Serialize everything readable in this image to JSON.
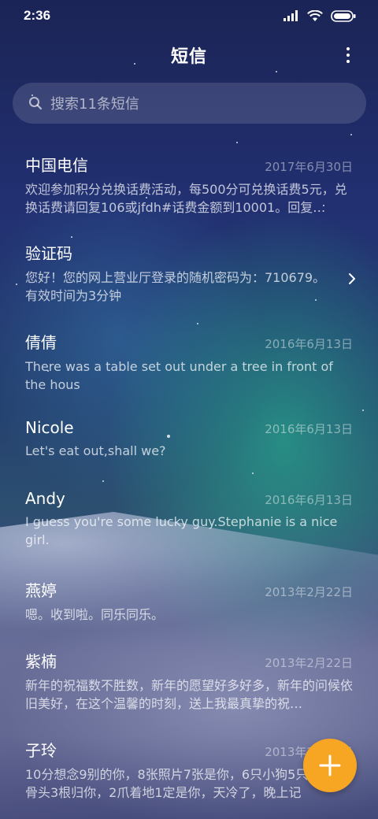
{
  "status_bar": {
    "time": "2:36",
    "icons": [
      "signal-icon",
      "wifi-icon",
      "battery-icon"
    ]
  },
  "header": {
    "title": "短信",
    "more_icon": "more-vertical-icon"
  },
  "search": {
    "icon": "search-icon",
    "placeholder": "搜索11条短信"
  },
  "conversations": [
    {
      "name": "中国电信",
      "date": "2017年6月30日",
      "preview": "欢迎参加积分兑换话费活动，每500分可兑换话费5元，兑换话费请回复106或jfdh#话费金额到10001。回复…"
    },
    {
      "name": "验证码",
      "date": "",
      "preview": "您好！您的网上营业厅登录的随机密码为：710679。有效时间为3分钟",
      "chevron": true
    },
    {
      "name": "倩倩",
      "date": "2016年6月13日",
      "preview": "There was a table set out under a tree in front of the hous"
    },
    {
      "name": "Nicole",
      "date": "2016年6月13日",
      "preview": "Let's eat out,shall we?"
    },
    {
      "name": "Andy",
      "date": "2016年6月13日",
      "preview": "I guess you're some lucky guy.Stephanie is a nice girl."
    },
    {
      "name": "燕婷",
      "date": "2013年2月22日",
      "preview": "嗯。收到啦。同乐同乐。"
    },
    {
      "name": "紫楠",
      "date": "2013年2月22日",
      "preview": "新年的祝福数不胜数，新年的愿望好多好多，新年的问候依旧美好，在这个温馨的时刻，送上我最真挚的祝…"
    },
    {
      "name": "子玲",
      "date": "2013年2月22日",
      "preview": "10分想念9别的你，8张照片7张是你，6只小狗5只…4根骨头3根归你，2爪着地1定是你，天冷了，晚上记"
    }
  ],
  "fab": {
    "icon": "plus-icon",
    "color": "#f6a623"
  }
}
